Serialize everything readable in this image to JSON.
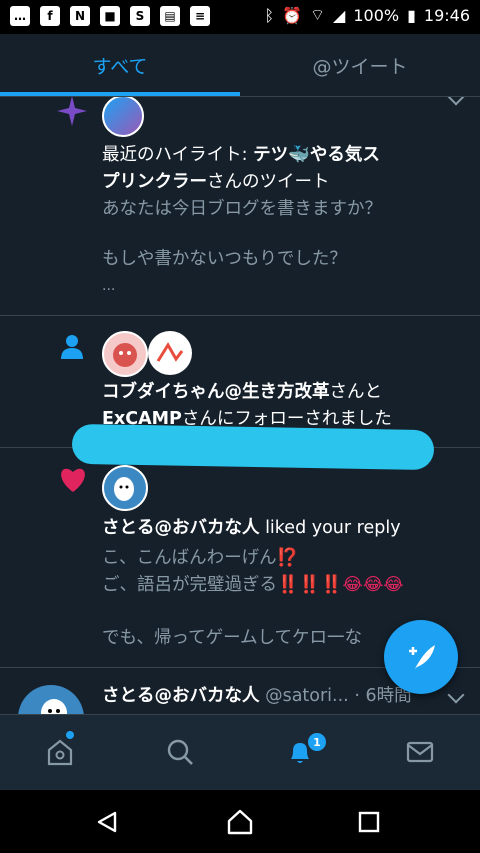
{
  "status_bar": {
    "battery": "100%",
    "time": "19:46"
  },
  "tabs": [
    {
      "label": "すべて"
    },
    {
      "label": "@ツイート"
    }
  ],
  "feed": {
    "item1": {
      "icon": "sparkle-icon",
      "line1_prefix": "最近のハイライト: ",
      "line1_name": "テツ🐳やる気ス",
      "line2_name": "プリンクラー",
      "line2_suffix": "さんのツイート",
      "body1": "あなたは今日ブログを書きますか？",
      "body2": "もしや書かないつもりでした？",
      "body3": "..."
    },
    "item2": {
      "icon": "person-icon",
      "name1": "コブダイちゃん@生き方改革",
      "and": "さんと",
      "name2": "ExCAMP",
      "suffix": "さんにフォローされました"
    },
    "item3": {
      "icon": "heart-icon",
      "name": "さとる@おバカな人",
      "action": " liked your reply",
      "body1_text": "こ、こんばんわーげん",
      "body1_emoji": "⁉️",
      "body2_text": "ご、語呂が完璧過ぎる",
      "body2_emoji": "‼️‼️‼️😂😂😂",
      "body3": "でも、帰ってゲームしてケロ一な"
    },
    "item4": {
      "name": "さとる@おバカな人",
      "handle": "@satori...",
      "time": "· 6時間"
    }
  },
  "bottom_nav": {
    "items": [
      "home-icon",
      "search-icon",
      "bell-icon",
      "mail-icon"
    ],
    "notification_count": "1"
  },
  "colors": {
    "background": "#15202b",
    "accent": "#1da1f2",
    "secondary_text": "#8899a6",
    "heart": "#e0245e",
    "sparkle": "#794bc4"
  }
}
